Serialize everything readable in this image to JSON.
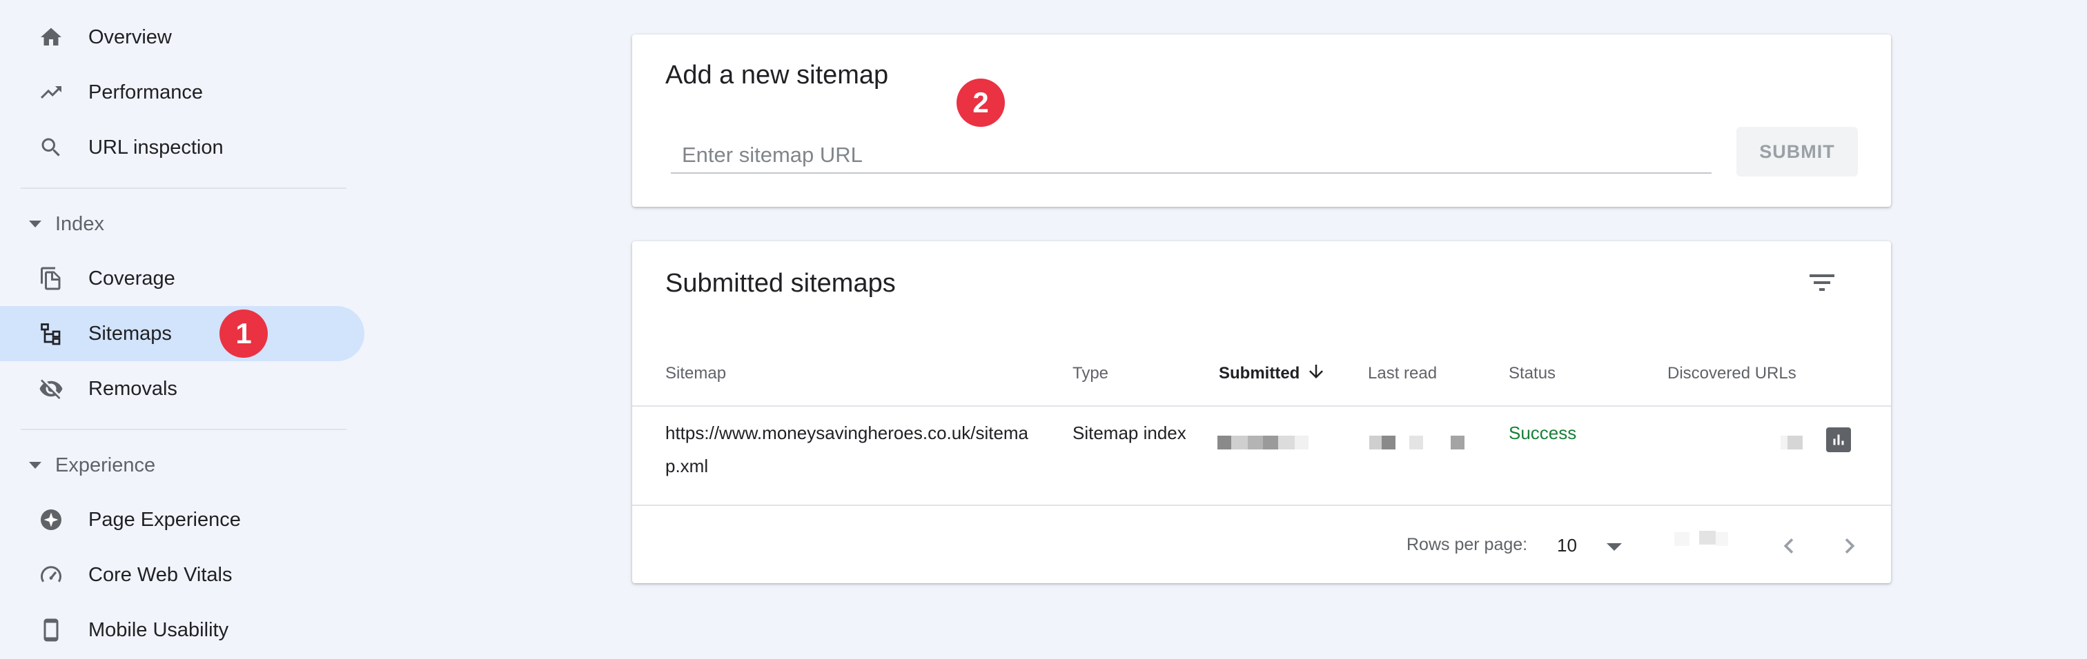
{
  "sidebar": {
    "items_top": [
      {
        "label": "Overview",
        "icon": "home-icon"
      },
      {
        "label": "Performance",
        "icon": "trending-up-icon"
      },
      {
        "label": "URL inspection",
        "icon": "search-icon"
      }
    ],
    "index_section": "Index",
    "index_items": [
      {
        "label": "Coverage",
        "icon": "copy-pages-icon"
      },
      {
        "label": "Sitemaps",
        "icon": "sitemap-icon",
        "active": true
      },
      {
        "label": "Removals",
        "icon": "eye-off-icon"
      }
    ],
    "experience_section": "Experience",
    "experience_items": [
      {
        "label": "Page Experience",
        "icon": "page-experience-icon"
      },
      {
        "label": "Core Web Vitals",
        "icon": "gauge-icon"
      },
      {
        "label": "Mobile Usability",
        "icon": "phone-icon"
      }
    ]
  },
  "annotations": {
    "step1": "1",
    "step2": "2",
    "color": "#ea3242"
  },
  "add_sitemap": {
    "title": "Add a new sitemap",
    "placeholder": "Enter sitemap URL",
    "value": "",
    "submit_label": "SUBMIT"
  },
  "submitted": {
    "title": "Submitted sitemaps",
    "columns": [
      "Sitemap",
      "Type",
      "Submitted",
      "Last read",
      "Status",
      "Discovered URLs"
    ],
    "sorted_column": "Submitted",
    "rows": [
      {
        "sitemap_line1": "https://www.moneysavingheroes.co.uk/sitema",
        "sitemap_line2": "p.xml",
        "type": "Sitemap index",
        "status": "Success"
      }
    ],
    "rows_per_page_label": "Rows per page:",
    "rows_per_page_value": "10"
  },
  "colors": {
    "accent": "#1a73e8",
    "active_bg": "#d2e3fc",
    "success": "#188038",
    "page_bg": "#f1f4fb"
  }
}
